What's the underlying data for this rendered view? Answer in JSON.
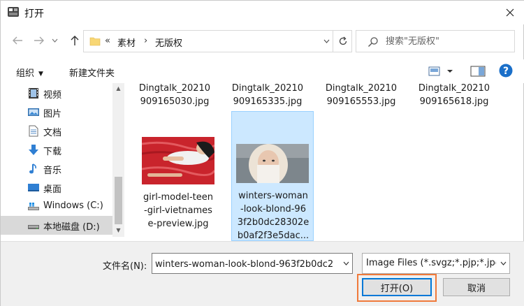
{
  "window": {
    "title": "打开"
  },
  "address": {
    "overflow": "«",
    "crumbs": [
      "素材",
      "无版权"
    ]
  },
  "search": {
    "placeholder": "搜索\"无版权\""
  },
  "toolbar": {
    "organize_label": "组织",
    "new_folder_label": "新建文件夹"
  },
  "sidebar": {
    "items": [
      {
        "label": "视频",
        "icon": "video-folder-icon"
      },
      {
        "label": "图片",
        "icon": "pictures-folder-icon"
      },
      {
        "label": "文档",
        "icon": "documents-folder-icon"
      },
      {
        "label": "下载",
        "icon": "downloads-folder-icon"
      },
      {
        "label": "音乐",
        "icon": "music-folder-icon"
      },
      {
        "label": "桌面",
        "icon": "desktop-folder-icon"
      },
      {
        "label": "Windows (C:)",
        "icon": "drive-icon"
      },
      {
        "label": "本地磁盘 (D:)",
        "icon": "drive-icon",
        "selected": true
      }
    ]
  },
  "files": {
    "top_row": [
      {
        "line1": "Dingtalk_20210",
        "line2": "909165030.jpg"
      },
      {
        "line1": "Dingtalk_20210",
        "line2": "909165335.jpg"
      },
      {
        "line1": "Dingtalk_20210",
        "line2": "909165553.jpg"
      },
      {
        "line1": "Dingtalk_20210",
        "line2": "909165618.jpg"
      }
    ],
    "second_row": [
      {
        "lines": [
          "girl-model-teen",
          "-girl-vietnames",
          "e-preview.jpg"
        ],
        "selected": false
      },
      {
        "lines": [
          "winters-woman",
          "-look-blond-96",
          "3f2b0dc28302e",
          "b0af2f3e5dac..."
        ],
        "selected": true
      }
    ]
  },
  "bottom": {
    "filename_label": "文件名(N):",
    "filename_value": "winters-woman-look-blond-963f2b0dc2",
    "filetype_value": "Image Files (*.svgz;*.pjp;*.jpe",
    "open_label": "打开(O)",
    "cancel_label": "取消"
  },
  "colors": {
    "selection": "#cce8ff",
    "highlight_outline": "#f07a3b",
    "accent": "#0078d7"
  }
}
